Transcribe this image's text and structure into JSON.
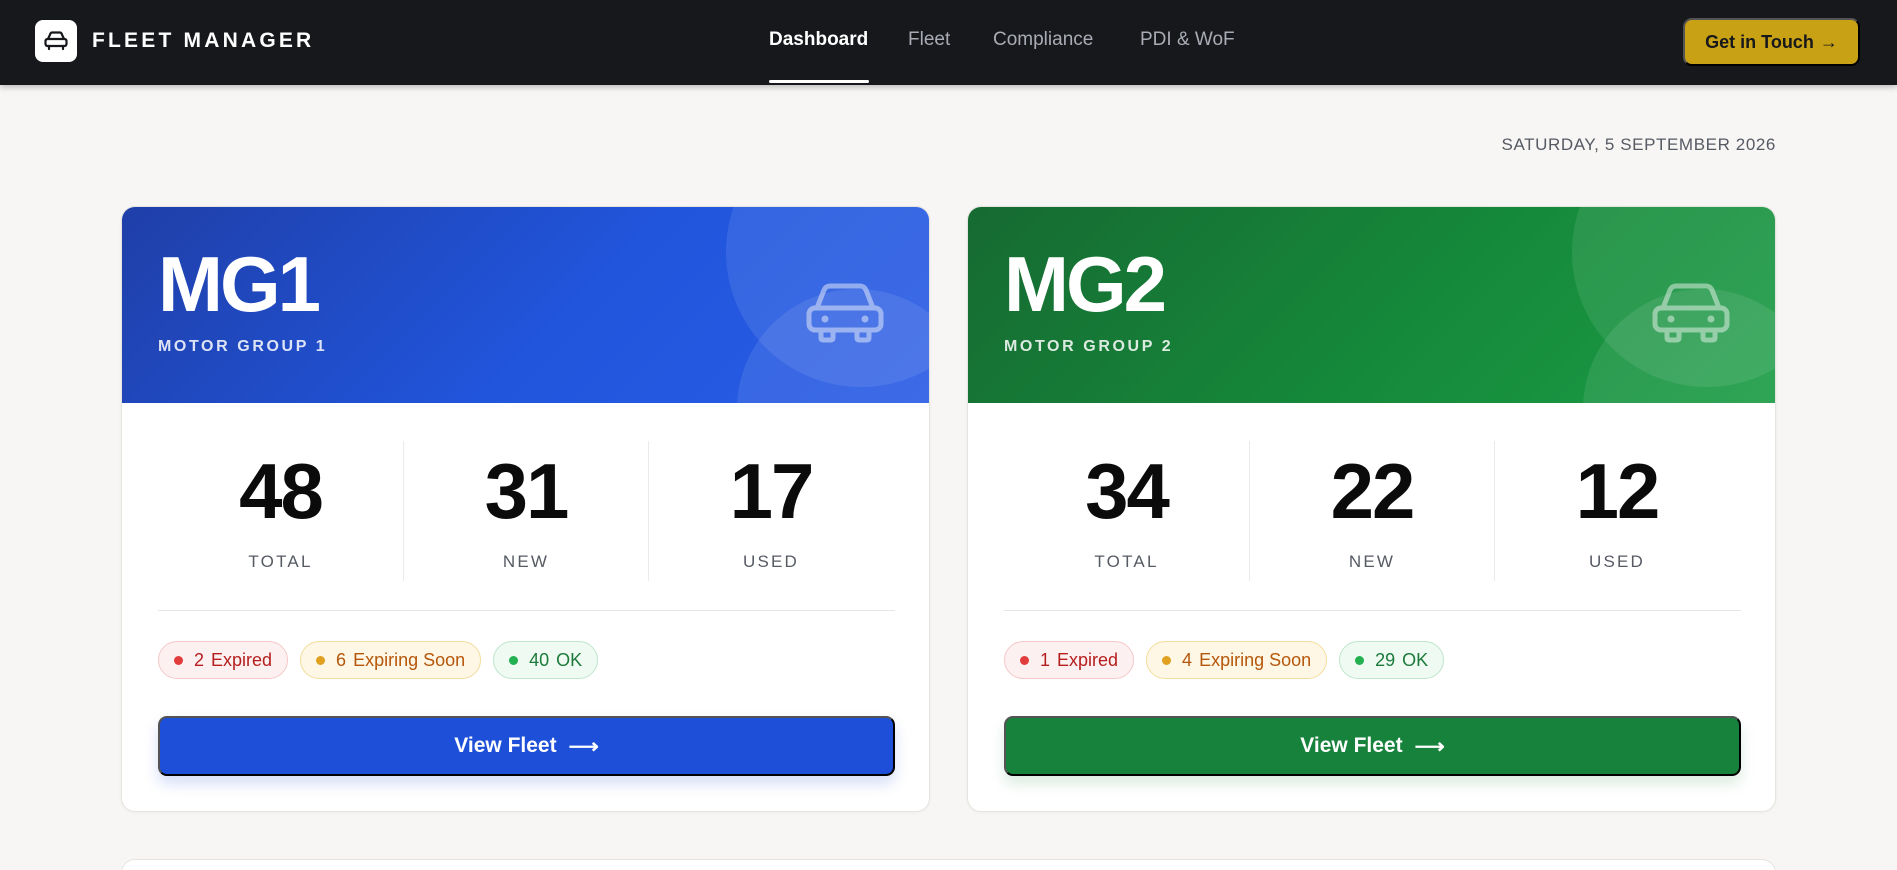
{
  "header": {
    "brand": "FLEET MANAGER",
    "nav": [
      "Dashboard",
      "Fleet",
      "Compliance",
      "PDI & WoF"
    ],
    "active_tab": "Dashboard",
    "cta_label": "Get in Touch",
    "cta_arrow": "→"
  },
  "date": "SATURDAY, 5 SEPTEMBER 2026",
  "groups": [
    {
      "code": "MG1",
      "name": "MOTOR GROUP 1",
      "accent": "#1e4fd8",
      "stats": [
        {
          "value": "48",
          "label": "TOTAL"
        },
        {
          "value": "31",
          "label": "NEW"
        },
        {
          "value": "17",
          "label": "USED"
        }
      ],
      "status": {
        "expired": {
          "count": "2",
          "label": "Expired"
        },
        "expiring": {
          "count": "6",
          "label": "Expiring Soon"
        },
        "ok": {
          "count": "40",
          "label": "OK"
        }
      },
      "button": "View Fleet",
      "button_arrow": "⟶"
    },
    {
      "code": "MG2",
      "name": "MOTOR GROUP 2",
      "accent": "#16823b",
      "stats": [
        {
          "value": "34",
          "label": "TOTAL"
        },
        {
          "value": "22",
          "label": "NEW"
        },
        {
          "value": "12",
          "label": "USED"
        }
      ],
      "status": {
        "expired": {
          "count": "1",
          "label": "Expired"
        },
        "expiring": {
          "count": "4",
          "label": "Expiring Soon"
        },
        "ok": {
          "count": "29",
          "label": "OK"
        }
      },
      "button": "View Fleet",
      "button_arrow": "⟶"
    }
  ],
  "icons": {
    "logo": "car-icon",
    "hero": "car-icon",
    "status_dot": "dot-icon",
    "arrow": "arrow-right-icon"
  }
}
